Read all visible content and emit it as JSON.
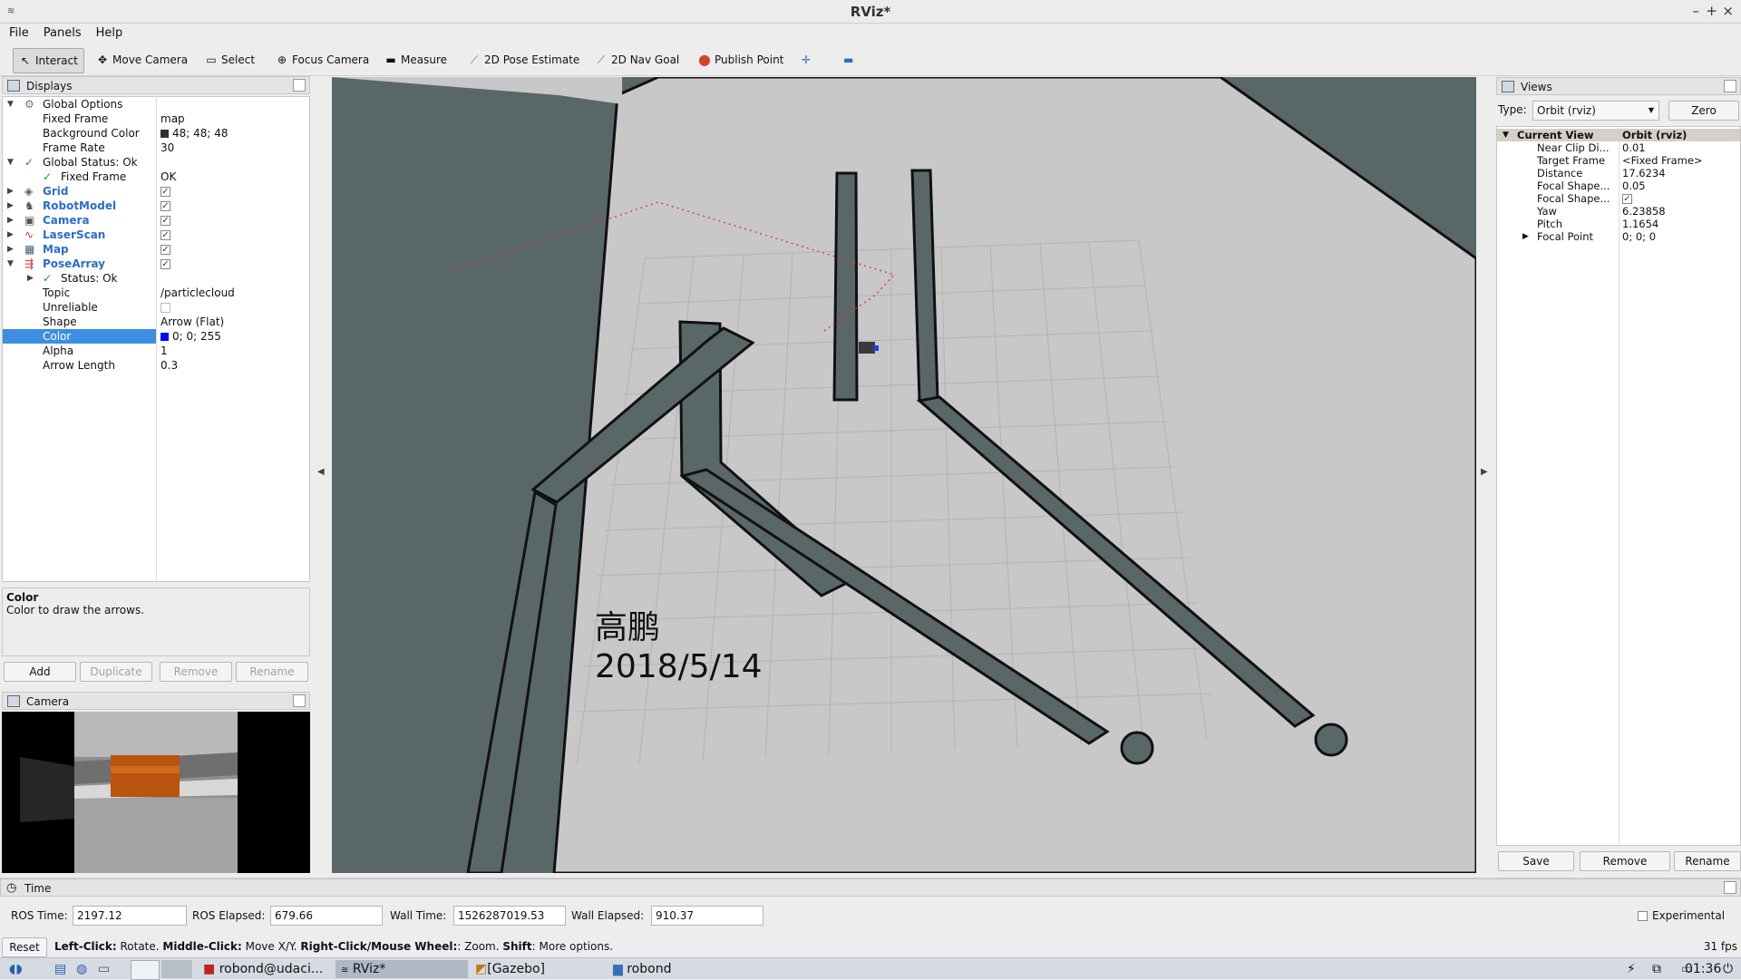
{
  "window": {
    "title": "RViz*",
    "controls": [
      "–",
      "+",
      "×"
    ]
  },
  "menu": [
    "File",
    "Panels",
    "Help"
  ],
  "toolbar": {
    "tools": [
      {
        "label": "Interact",
        "icon": "cursor-icon"
      },
      {
        "label": "Move Camera",
        "icon": "move-camera-icon"
      },
      {
        "label": "Select",
        "icon": "select-icon"
      },
      {
        "label": "Focus Camera",
        "icon": "focus-camera-icon"
      },
      {
        "label": "Measure",
        "icon": "measure-icon"
      },
      {
        "label": "2D Pose Estimate",
        "icon": "pose-estimate-icon"
      },
      {
        "label": "2D Nav Goal",
        "icon": "nav-goal-icon"
      },
      {
        "label": "Publish Point",
        "icon": "publish-point-icon"
      }
    ]
  },
  "displays": {
    "title": "Displays",
    "rows": [
      {
        "key": "Global Options",
        "value": ""
      },
      {
        "key": "Fixed Frame",
        "value": "map"
      },
      {
        "key": "Background Color",
        "value": "48; 48; 48"
      },
      {
        "key": "Frame Rate",
        "value": "30"
      },
      {
        "key": "Global Status: Ok",
        "value": ""
      },
      {
        "key": "Fixed Frame",
        "value": "OK"
      },
      {
        "key": "Grid",
        "value": ""
      },
      {
        "key": "RobotModel",
        "value": ""
      },
      {
        "key": "Camera",
        "value": ""
      },
      {
        "key": "LaserScan",
        "value": ""
      },
      {
        "key": "Map",
        "value": ""
      },
      {
        "key": "PoseArray",
        "value": ""
      },
      {
        "key": "Status: Ok",
        "value": ""
      },
      {
        "key": "Topic",
        "value": "/particlecloud"
      },
      {
        "key": "Unreliable",
        "value": ""
      },
      {
        "key": "Shape",
        "value": "Arrow (Flat)"
      },
      {
        "key": "Color",
        "value": "0; 0; 255"
      },
      {
        "key": "Alpha",
        "value": "1"
      },
      {
        "key": "Arrow Length",
        "value": "0.3"
      }
    ],
    "description_title": "Color",
    "description_text": "Color to draw the arrows.",
    "buttons": [
      "Add",
      "Duplicate",
      "Remove",
      "Rename"
    ]
  },
  "camera_panel": {
    "title": "Camera"
  },
  "overlay": {
    "name": "高鹏",
    "date": "2018/5/14"
  },
  "views": {
    "title": "Views",
    "type_label": "Type:",
    "type_value": "Orbit (rviz)",
    "zero_label": "Zero",
    "header_key": "Current View",
    "header_value": "Orbit (rviz)",
    "rows": [
      {
        "key": "Near Clip Di...",
        "value": "0.01"
      },
      {
        "key": "Target Frame",
        "value": "<Fixed Frame>"
      },
      {
        "key": "Distance",
        "value": "17.6234"
      },
      {
        "key": "Focal Shape...",
        "value": "0.05"
      },
      {
        "key": "Focal Shape...",
        "value": "✓"
      },
      {
        "key": "Yaw",
        "value": "6.23858"
      },
      {
        "key": "Pitch",
        "value": "1.1654"
      },
      {
        "key": "Focal Point",
        "value": "0; 0; 0"
      }
    ],
    "buttons": [
      "Save",
      "Remove",
      "Rename"
    ]
  },
  "time": {
    "title": "Time",
    "ros_time_label": "ROS Time:",
    "ros_time": "2197.12",
    "ros_elapsed_label": "ROS Elapsed:",
    "ros_elapsed": "679.66",
    "wall_time_label": "Wall Time:",
    "wall_time": "1526287019.53",
    "wall_elapsed_label": "Wall Elapsed:",
    "wall_elapsed": "910.37",
    "experimental_label": "Experimental"
  },
  "status": {
    "reset_label": "Reset",
    "hint_b1": "Left-Click:",
    "hint_t1": " Rotate. ",
    "hint_b2": "Middle-Click:",
    "hint_t2": " Move X/Y. ",
    "hint_b3": "Right-Click/Mouse Wheel:",
    "hint_t3": ": Zoom. ",
    "hint_b4": "Shift",
    "hint_t4": ": More options.",
    "fps": "31 fps"
  },
  "taskbar": {
    "items": [
      "robond@udaci...",
      "RViz*",
      "[Gazebo]",
      "robond"
    ],
    "clock": "01:36"
  },
  "colors": {
    "map_wall": "#5a6768",
    "map_floor": "#c8c8c8",
    "selection": "#3d8ee1",
    "link_blue": "#2a6fc4"
  }
}
